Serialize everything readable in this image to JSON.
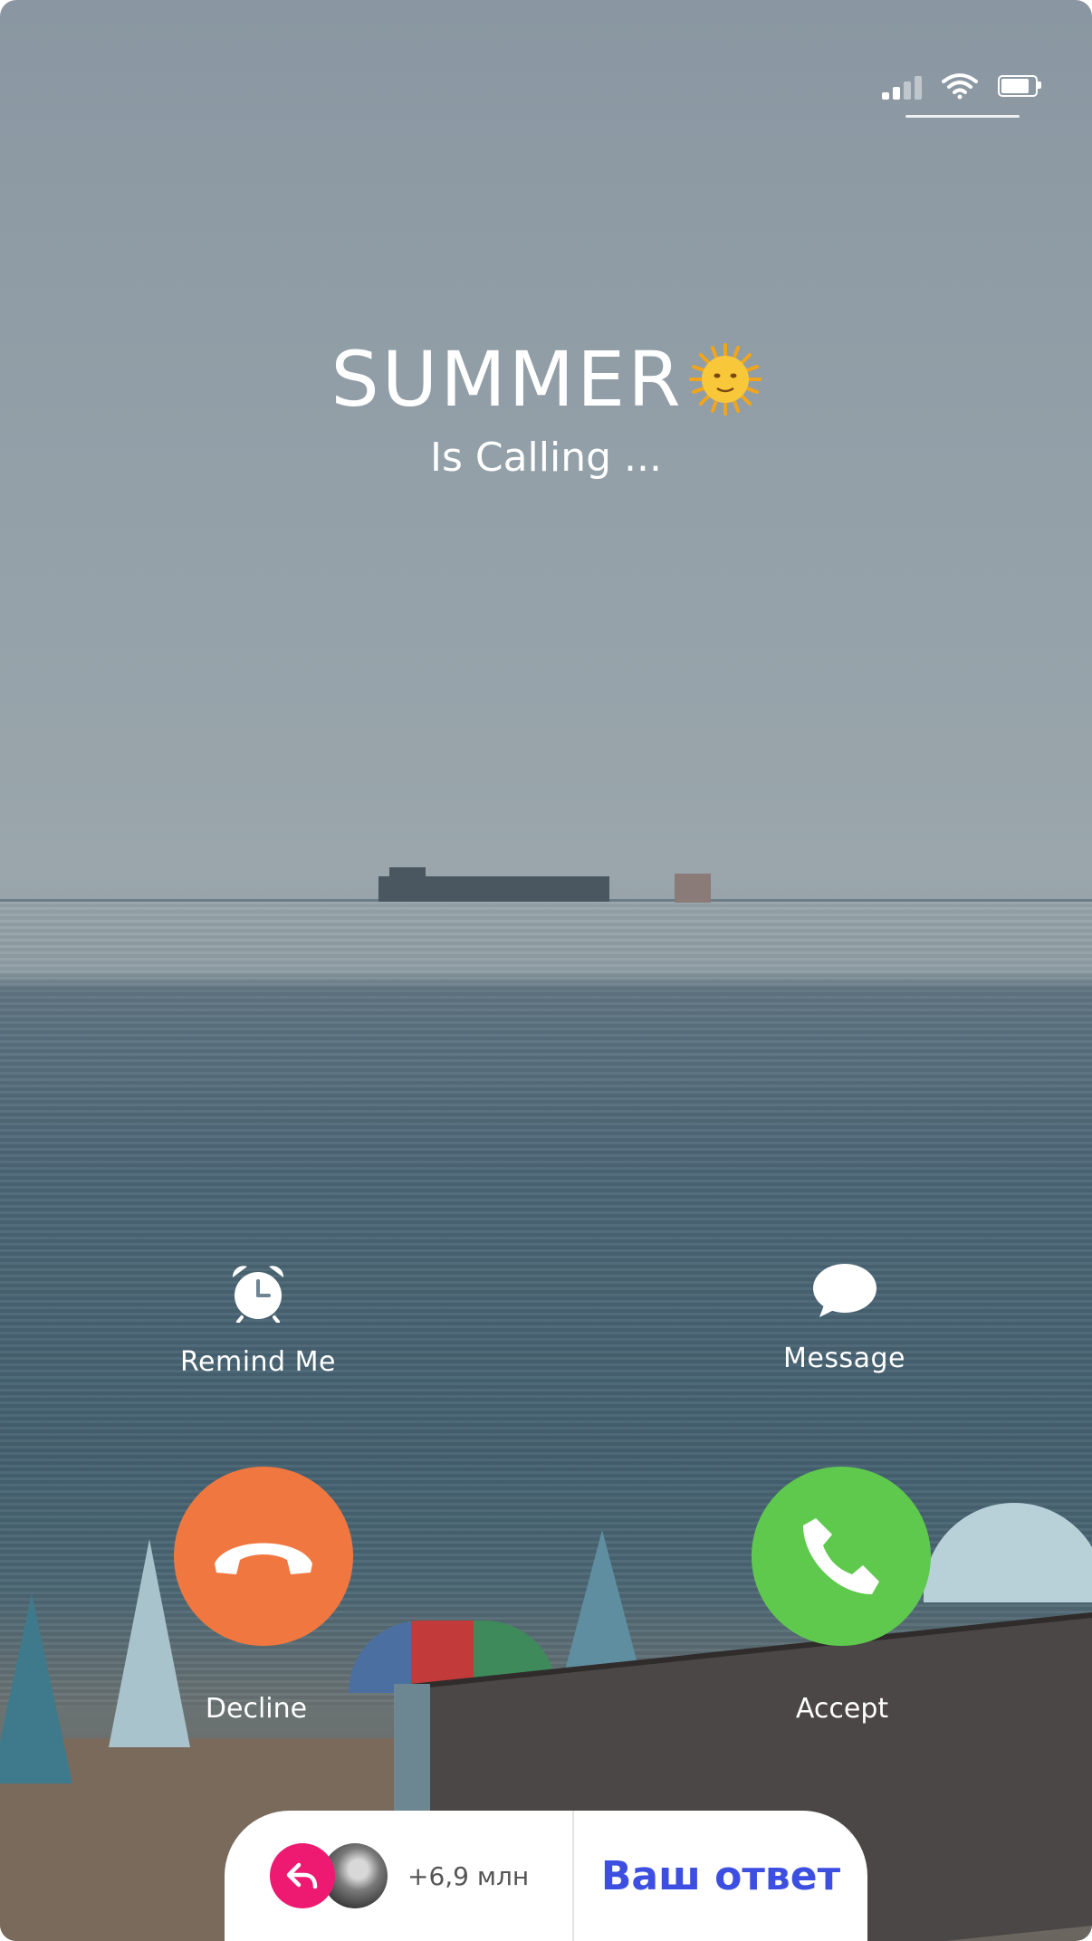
{
  "caller": {
    "name": "SUMMER",
    "status": "Is Calling ..."
  },
  "actions": {
    "remind_label": "Remind Me",
    "message_label": "Message"
  },
  "buttons": {
    "decline_label": "Decline",
    "accept_label": "Accept"
  },
  "reply_bar": {
    "count": "+6,9 млн",
    "answer_label": "Ваш ответ"
  },
  "colors": {
    "decline": "#f07840",
    "accept": "#5fc94e",
    "reply_accent": "#ee1a72",
    "answer_text": "#3d4fe0"
  },
  "icons": [
    "signal-icon",
    "wifi-icon",
    "battery-icon",
    "sun-emoji-icon",
    "alarm-clock-icon",
    "message-bubble-icon",
    "phone-hangup-icon",
    "phone-icon",
    "reply-arrow-icon"
  ]
}
